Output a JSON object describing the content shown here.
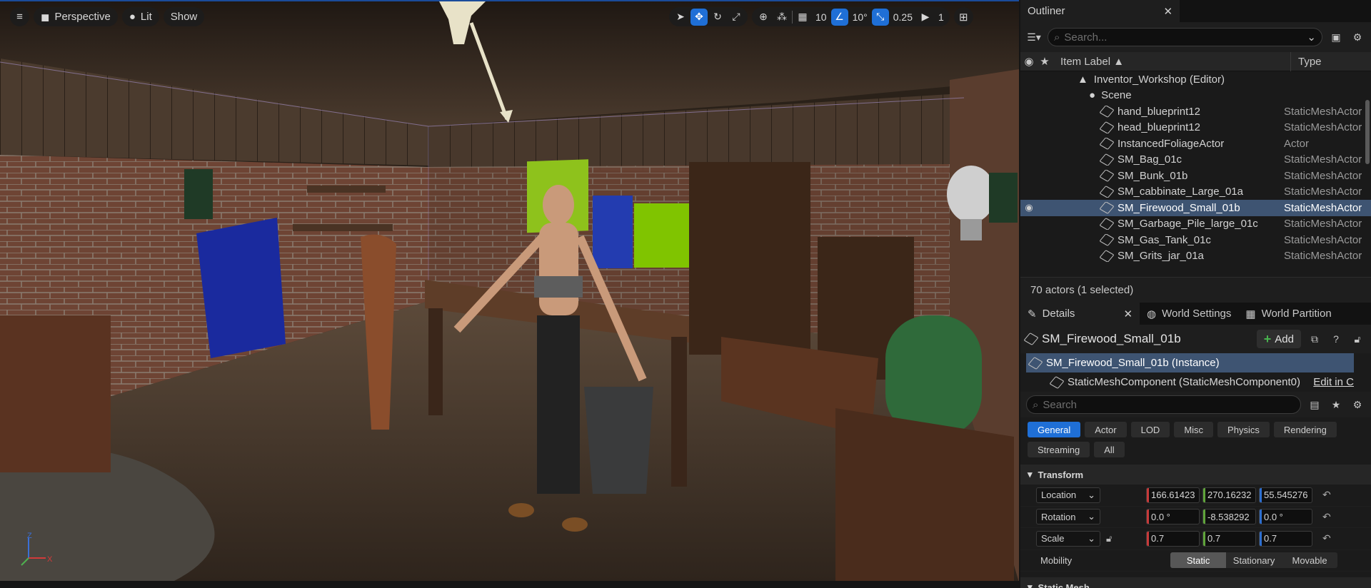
{
  "viewport": {
    "perspective_label": "Perspective",
    "lit_label": "Lit",
    "show_label": "Show",
    "grid_snap": "10",
    "rotation_snap": "10°",
    "scale_snap": "0.25",
    "camera_speed": "1",
    "axis_x": "X",
    "axis_z": "Z"
  },
  "outliner": {
    "tab_label": "Outliner",
    "search_placeholder": "Search...",
    "col_label": "Item Label",
    "col_type": "Type",
    "world_label": "Inventor_Workshop (Editor)",
    "scene_label": "Scene",
    "rows": [
      {
        "label": "hand_blueprint12",
        "type": "StaticMeshActor"
      },
      {
        "label": "head_blueprint12",
        "type": "StaticMeshActor"
      },
      {
        "label": "InstancedFoliageActor",
        "type": "Actor"
      },
      {
        "label": "SM_Bag_01c",
        "type": "StaticMeshActor"
      },
      {
        "label": "SM_Bunk_01b",
        "type": "StaticMeshActor"
      },
      {
        "label": "SM_cabbinate_Large_01a",
        "type": "StaticMeshActor"
      },
      {
        "label": "SM_Firewood_Small_01b",
        "type": "StaticMeshActor"
      },
      {
        "label": "SM_Garbage_Pile_large_01c",
        "type": "StaticMeshActor"
      },
      {
        "label": "SM_Gas_Tank_01c",
        "type": "StaticMeshActor"
      },
      {
        "label": "SM_Grits_jar_01a",
        "type": "StaticMeshActor"
      }
    ],
    "status": "70 actors (1 selected)"
  },
  "details": {
    "tab_label": "Details",
    "world_settings_label": "World Settings",
    "world_partition_label": "World Partition",
    "object_name": "SM_Firewood_Small_01b",
    "add_label": "Add",
    "instance_label": "SM_Firewood_Small_01b (Instance)",
    "component_label": "StaticMeshComponent (StaticMeshComponent0)",
    "edit_label": "Edit in C",
    "search_placeholder": "Search",
    "filters": [
      "General",
      "Actor",
      "LOD",
      "Misc",
      "Physics",
      "Rendering",
      "Streaming",
      "All"
    ],
    "transform_label": "Transform",
    "location_label": "Location",
    "rotation_label": "Rotation",
    "scale_label": "Scale",
    "mobility_label": "Mobility",
    "location": {
      "x": "166.61423",
      "y": "270.16232",
      "z": "55.545276"
    },
    "rotation": {
      "x": "0.0 °",
      "y": "-8.538292",
      "z": "0.0 °"
    },
    "scale": {
      "x": "0.7",
      "y": "0.7",
      "z": "0.7"
    },
    "mobility_options": [
      "Static",
      "Stationary",
      "Movable"
    ],
    "next_section_label": "Static Mesh"
  },
  "colors": {
    "accent": "#1f6fd6",
    "selection": "#3e5472",
    "panel": "#1b1b1b"
  }
}
